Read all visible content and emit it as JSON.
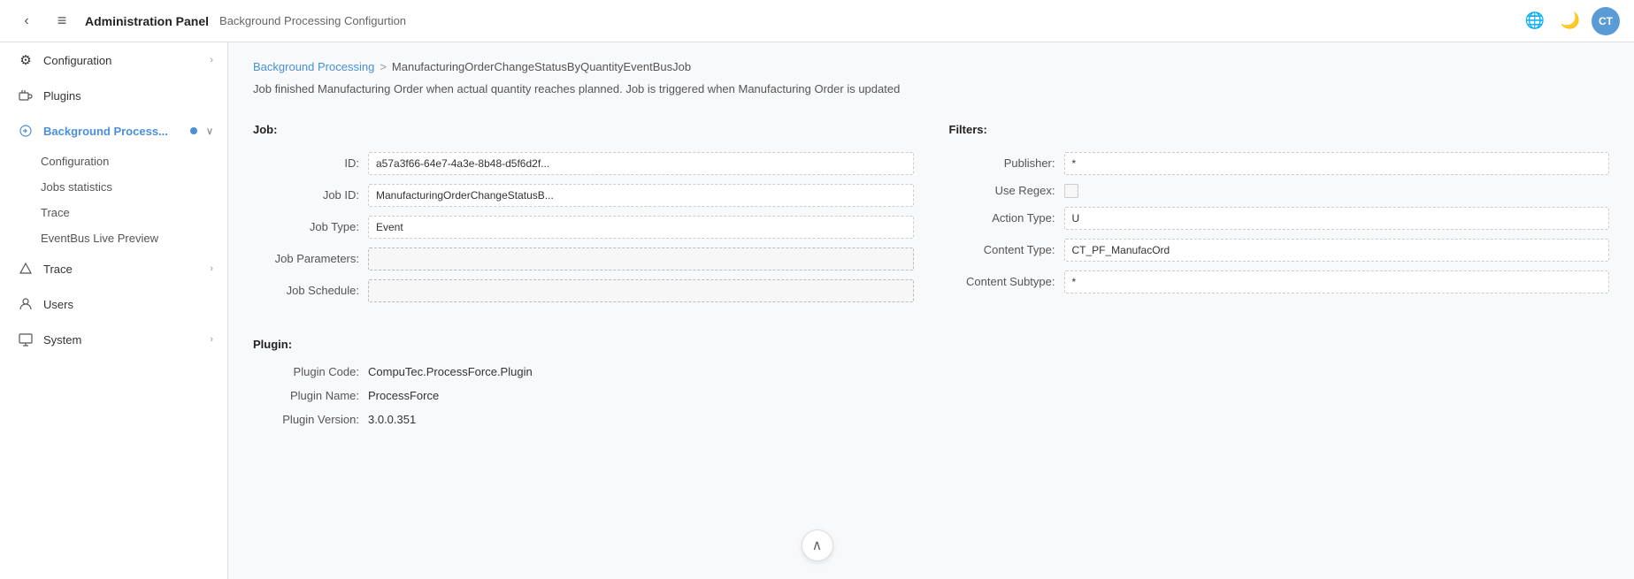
{
  "topbar": {
    "title": "Administration Panel",
    "subtitle": "Background Processing Configurtion",
    "back_icon": "‹",
    "menu_icon": "≡",
    "globe_icon": "🌐",
    "moon_icon": "🌙",
    "avatar_label": "CT"
  },
  "sidebar": {
    "items": [
      {
        "id": "configuration",
        "label": "Configuration",
        "icon": "⚙",
        "has_chevron": true
      },
      {
        "id": "plugins",
        "label": "Plugins",
        "icon": "🔌",
        "has_chevron": false
      },
      {
        "id": "background-processing",
        "label": "Background Process...",
        "icon": "⚡",
        "has_chevron": true,
        "active": true,
        "has_dot": true
      },
      {
        "id": "trace",
        "label": "Trace",
        "icon": "△",
        "has_chevron": true
      },
      {
        "id": "users",
        "label": "Users",
        "icon": "👤",
        "has_chevron": false
      },
      {
        "id": "system",
        "label": "System",
        "icon": "🖥",
        "has_chevron": true
      }
    ],
    "sub_items": [
      {
        "id": "config-sub",
        "label": "Configuration"
      },
      {
        "id": "jobs-statistics",
        "label": "Jobs statistics"
      },
      {
        "id": "trace-sub",
        "label": "Trace"
      },
      {
        "id": "eventbus-live-preview",
        "label": "EventBus Live Preview"
      }
    ]
  },
  "breadcrumb": {
    "link_text": "Background Processing",
    "separator": ">",
    "current": "ManufacturingOrderChangeStatusByQuantityEventBusJob"
  },
  "page_description": "Job finished Manufacturing Order when actual quantity reaches planned. Job is triggered when Manufacturing Order is updated",
  "job_section": {
    "title": "Job:",
    "fields": [
      {
        "label": "ID:",
        "value": "a57a3f66-64e7-4a3e-8b48-d5f6d2f...",
        "empty": false
      },
      {
        "label": "Job ID:",
        "value": "ManufacturingOrderChangeStatusB...",
        "empty": false
      },
      {
        "label": "Job Type:",
        "value": "Event",
        "empty": false
      },
      {
        "label": "Job Parameters:",
        "value": "",
        "empty": true
      },
      {
        "label": "Job Schedule:",
        "value": "",
        "empty": true
      }
    ]
  },
  "filters_section": {
    "title": "Filters:",
    "fields": [
      {
        "label": "Publisher:",
        "value": "*",
        "type": "input",
        "empty": false
      },
      {
        "label": "Use Regex:",
        "value": "",
        "type": "checkbox"
      },
      {
        "label": "Action Type:",
        "value": "U",
        "type": "input",
        "empty": false
      },
      {
        "label": "Content Type:",
        "value": "CT_PF_ManufacOrd",
        "type": "input",
        "empty": false
      },
      {
        "label": "Content Subtype:",
        "value": "*",
        "type": "input",
        "empty": false
      }
    ]
  },
  "plugin_section": {
    "title": "Plugin:",
    "fields": [
      {
        "label": "Plugin Code:",
        "value": "CompuTec.ProcessForce.Plugin"
      },
      {
        "label": "Plugin Name:",
        "value": "ProcessForce"
      },
      {
        "label": "Plugin Version:",
        "value": "3.0.0.351"
      }
    ]
  }
}
